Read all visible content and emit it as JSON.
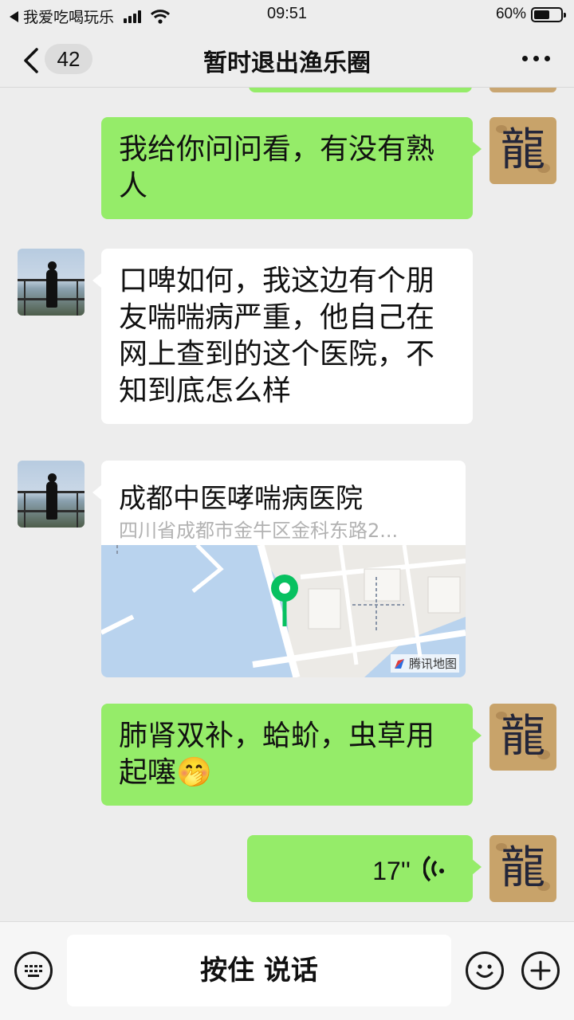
{
  "status_bar": {
    "back_app": "我爱吃喝玩乐",
    "time": "09:51",
    "battery": "60%",
    "battery_level": 0.6
  },
  "nav": {
    "unread_count": "42",
    "title": "暂时退出渔乐圈"
  },
  "messages": [
    {
      "side": "me",
      "type": "text",
      "text": "我给你问问看，有没有熟人",
      "avatar_char": "龍"
    },
    {
      "side": "them",
      "type": "text",
      "text": "口啤如何，我这边有个朋友喘喘病严重，他自己在网上查到的这个医院，不知到底怎么样"
    },
    {
      "side": "them",
      "type": "location",
      "place_name": "成都中医哮喘病医院",
      "address": "四川省成都市金牛区金科东路2...",
      "map_provider": "腾讯地图"
    },
    {
      "side": "me",
      "type": "text",
      "text": "肺肾双补，蛤蚧，虫草用起噻",
      "emoji": "🤭",
      "avatar_char": "龍"
    },
    {
      "side": "me",
      "type": "voice",
      "duration": "17''",
      "avatar_char": "龍"
    }
  ],
  "input_bar": {
    "hold_to_talk": "按住 说话"
  },
  "colors": {
    "my_bubble": "#95ec69",
    "their_bubble": "#ffffff",
    "background": "#ededed",
    "map_pin": "#07c160"
  },
  "icons": [
    "back-chevron-icon",
    "more-icon",
    "keyboard-icon",
    "emoji-icon",
    "plus-icon",
    "voice-wave-icon",
    "map-pin-icon"
  ]
}
